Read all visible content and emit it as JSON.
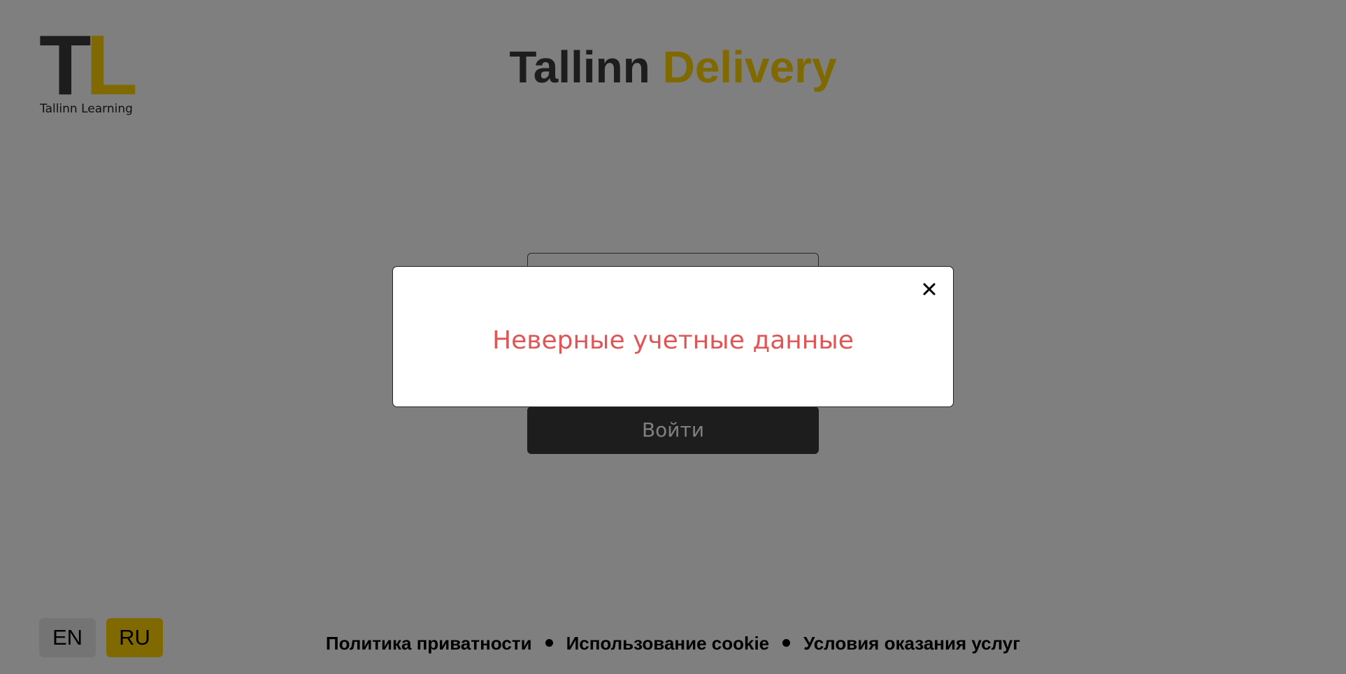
{
  "logo": {
    "letter_t": "T",
    "letter_l": "L",
    "caption": "Tallinn Learning"
  },
  "header": {
    "title_part1": "Tallinn",
    "title_part2": "Delivery"
  },
  "login": {
    "submit_label": "Войти"
  },
  "language": {
    "options": [
      "EN",
      "RU"
    ],
    "selected": "RU"
  },
  "footer": {
    "links": [
      "Политика приватности",
      "Использование cookie",
      "Условия оказания услуг"
    ]
  },
  "modal": {
    "message": "Неверные учетные данные",
    "close_icon": "close-icon"
  },
  "colors": {
    "accent": "#ffd200",
    "dark": "#3a3a3a",
    "error": "#e05555",
    "overlay": "rgba(0,0,0,0.5)"
  }
}
